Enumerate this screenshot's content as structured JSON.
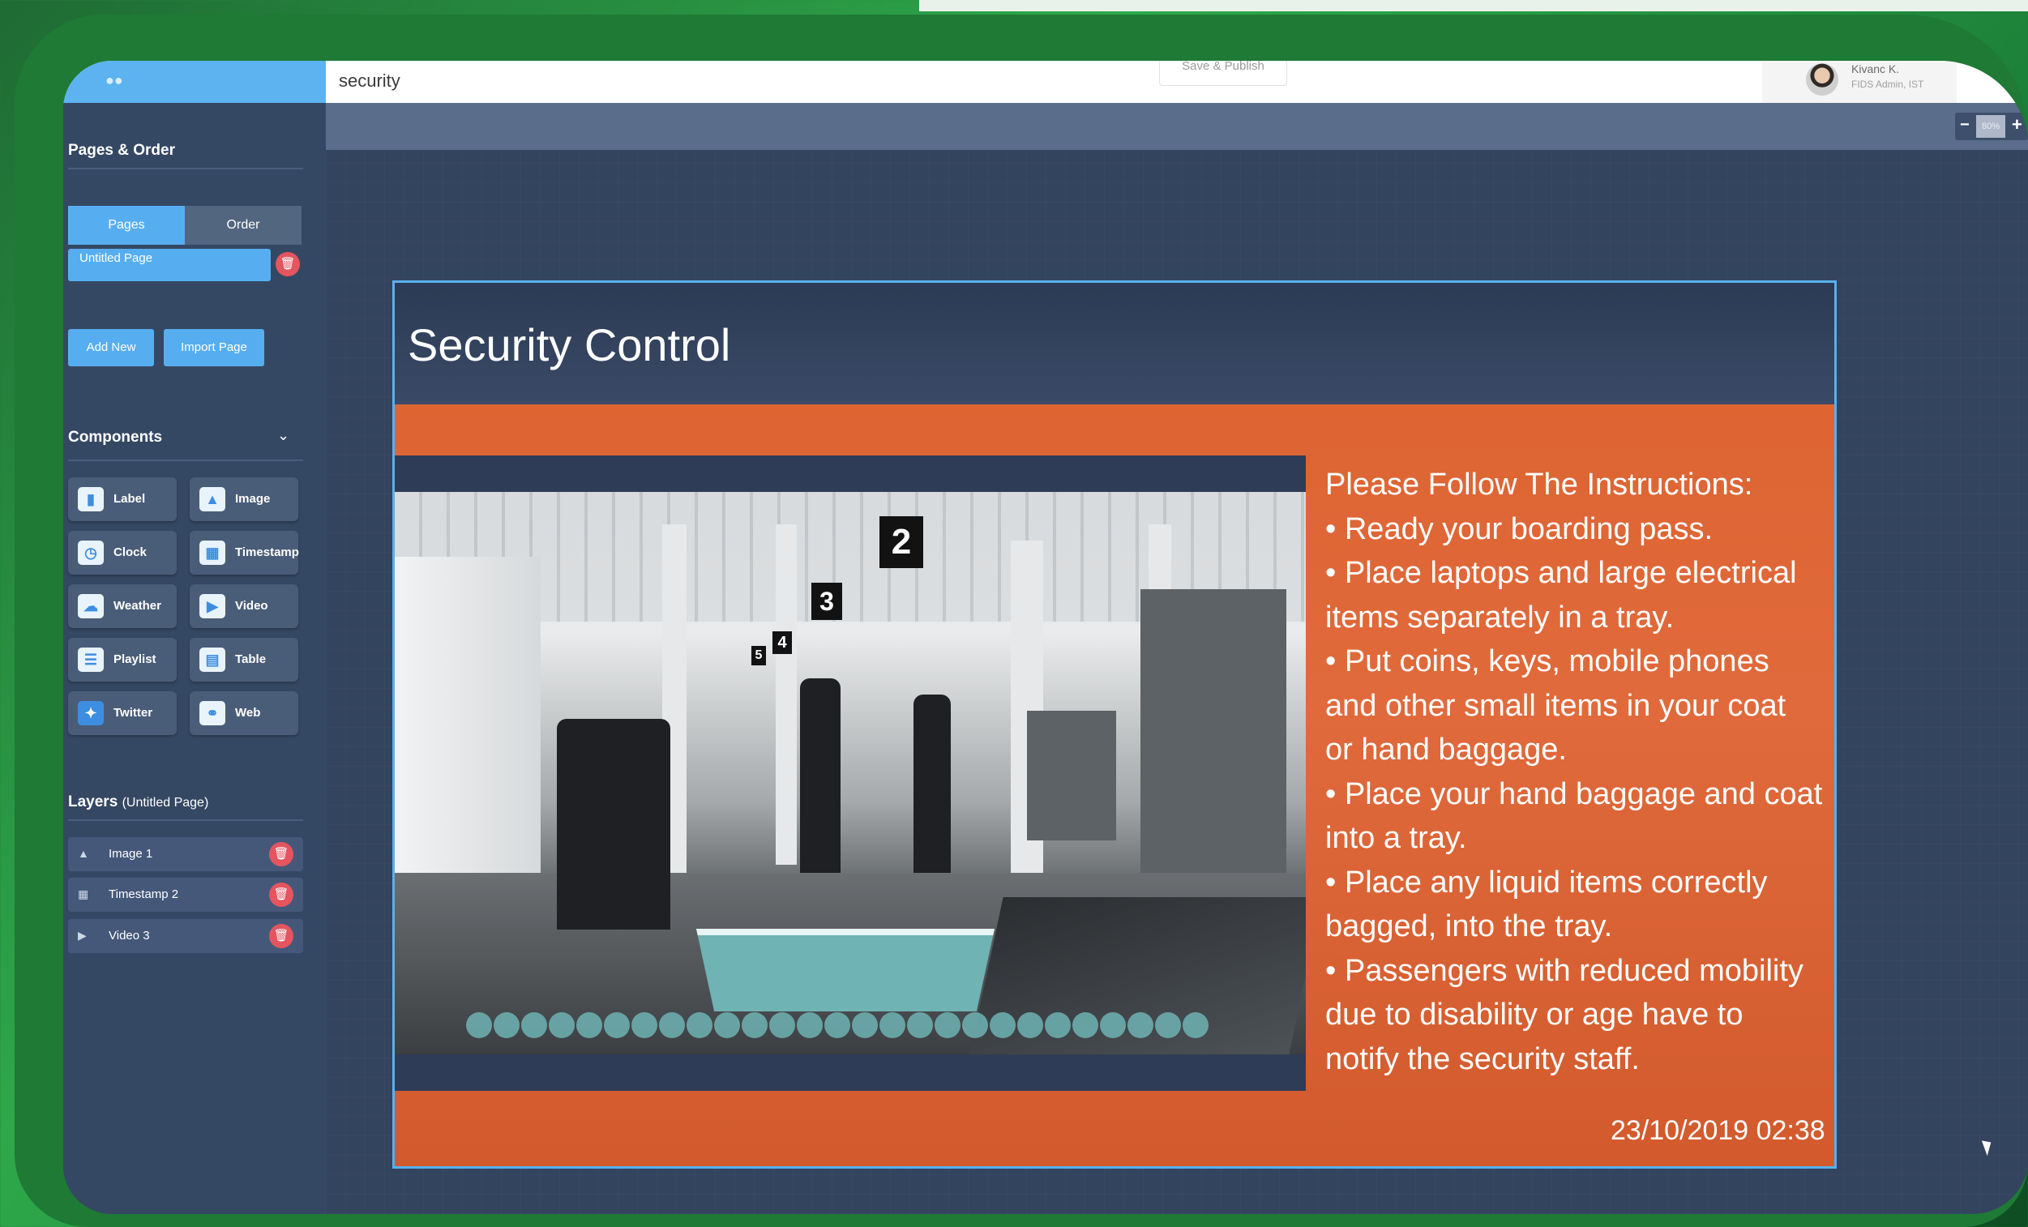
{
  "app": {
    "page_name": "security",
    "save_label": "Save & Publish",
    "user_name": "Kivanc K.",
    "user_role": "FIDS Admin, IST"
  },
  "sidebar": {
    "pages_title": "Pages & Order",
    "tabs": [
      "Pages",
      "Order"
    ],
    "page_item": "Untitled Page",
    "add_new": "Add New",
    "import_page": "Import Page",
    "components_title": "Components",
    "components": [
      {
        "label": "Label",
        "icon": "label-icon"
      },
      {
        "label": "Image",
        "icon": "image-icon"
      },
      {
        "label": "Clock",
        "icon": "clock-icon"
      },
      {
        "label": "Timestamp",
        "icon": "calendar-icon"
      },
      {
        "label": "Weather",
        "icon": "weather-icon"
      },
      {
        "label": "Video",
        "icon": "video-icon"
      },
      {
        "label": "Playlist",
        "icon": "playlist-icon"
      },
      {
        "label": "Table",
        "icon": "table-icon"
      },
      {
        "label": "Twitter",
        "icon": "twitter-icon"
      },
      {
        "label": "Web",
        "icon": "globe-icon"
      }
    ],
    "layers_title": "Layers",
    "layers_sub": "(Untitled Page)",
    "layers": [
      {
        "label": "Image 1",
        "icon": "image-icon"
      },
      {
        "label": "Timestamp 2",
        "icon": "calendar-icon"
      },
      {
        "label": "Video 3",
        "icon": "play-icon"
      }
    ]
  },
  "toolbar": {
    "zoom_value": "80%"
  },
  "slide": {
    "title": "Security Control",
    "instructions": [
      "Please Follow The Instructions:",
      "• Ready your boarding pass.",
      "• Place laptops and large electrical",
      "items separately in a tray.",
      "• Put coins, keys, mobile phones",
      "and other small items in your coat",
      "or hand baggage.",
      "• Place your hand baggage and coat",
      "into a tray.",
      "• Place any liquid items correctly",
      "bagged, into the tray.",
      "• Passengers with reduced mobility",
      "due to disability or age have to",
      "notify the security staff."
    ],
    "timestamp": "23/10/2019 02:38",
    "photo_signs": [
      "2",
      "3",
      "4",
      "5"
    ]
  },
  "colors": {
    "accent": "#56aef0",
    "slide_orange": "#de6432",
    "sidebar_bg": "#354863",
    "delete_red": "#e4555f"
  }
}
